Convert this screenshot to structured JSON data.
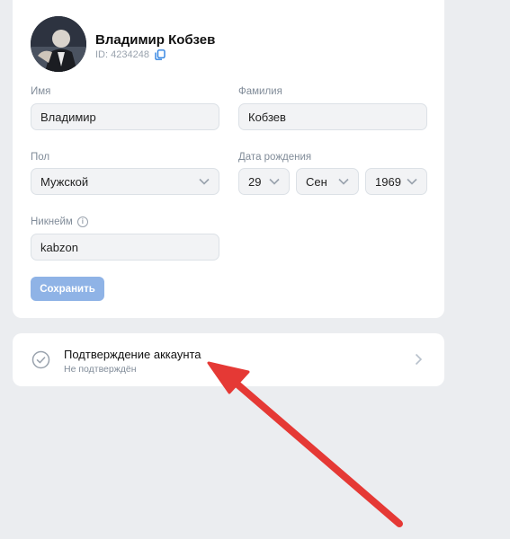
{
  "profile": {
    "name": "Владимир Кобзев",
    "id_text": "ID: 4234248",
    "avatar_icon": "user-avatar-photo"
  },
  "form": {
    "first_name": {
      "label": "Имя",
      "value": "Владимир"
    },
    "last_name": {
      "label": "Фамилия",
      "value": "Кобзев"
    },
    "gender": {
      "label": "Пол",
      "value": "Мужской"
    },
    "birth_date": {
      "label": "Дата рождения",
      "day": "29",
      "month": "Сен",
      "year": "1969"
    },
    "nickname": {
      "label": "Никнейм",
      "value": "kabzon"
    },
    "save_label": "Сохранить"
  },
  "verification": {
    "title": "Подтверждение аккаунта",
    "status": "Не подтверждён"
  },
  "colors": {
    "background": "#ebedf0",
    "card": "#ffffff",
    "accent": "#2d81e0",
    "save_button_disabled": "#8fb3e6",
    "annotation_arrow": "#e53935"
  }
}
